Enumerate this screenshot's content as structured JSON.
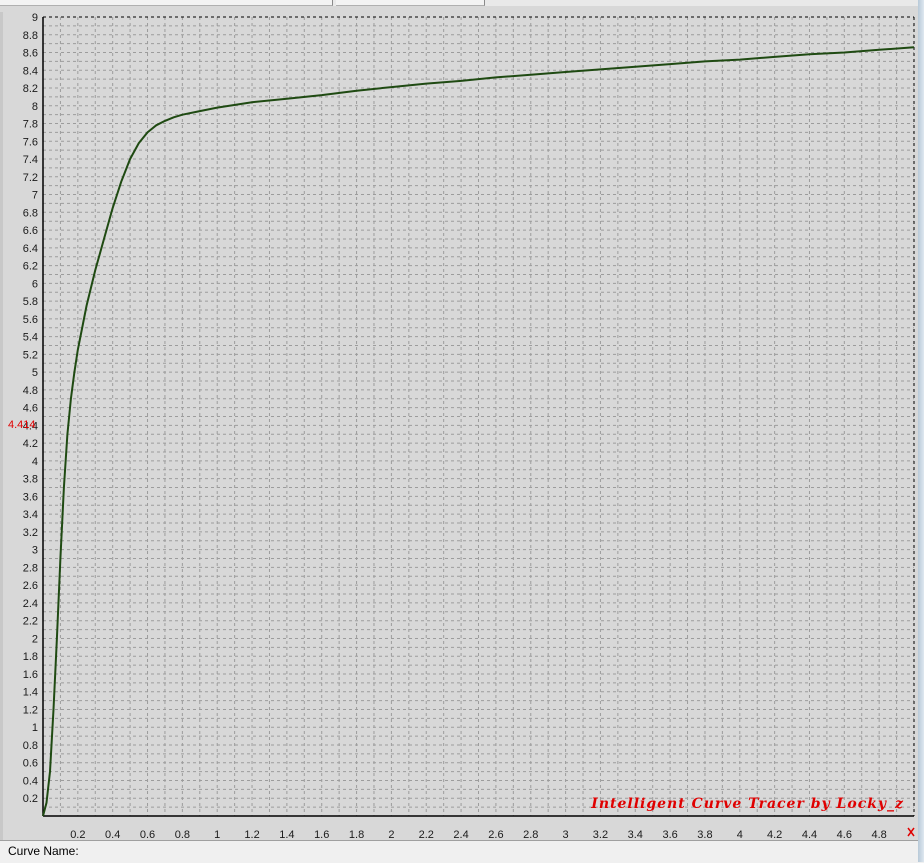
{
  "status_bar": {
    "curve_name_label": "Curve Name:"
  },
  "watermark": "Intelligent Curve Tracer by Locky_z",
  "cursor": {
    "y_value_label": "4.414"
  },
  "colors": {
    "curve": "#1f4a12",
    "grid": "#9c9c9c",
    "background": "#d8d8d8",
    "accent_red": "#e00000"
  },
  "chart_data": {
    "type": "line",
    "xlim": [
      0,
      5
    ],
    "ylim": [
      0,
      9
    ],
    "grid": true,
    "x_ticks": [
      0.2,
      0.4,
      0.6,
      0.8,
      1,
      1.2,
      1.4,
      1.6,
      1.8,
      2,
      2.2,
      2.4,
      2.6,
      2.8,
      3,
      3.2,
      3.4,
      3.6,
      3.8,
      4,
      4.2,
      4.4,
      4.6,
      4.8
    ],
    "x_tick_labels": [
      "0.2",
      "0.4",
      "0.6",
      "0.8",
      "1",
      "1.2",
      "1.4",
      "1.6",
      "1.8",
      "2",
      "2.2",
      "2.4",
      "2.6",
      "2.8",
      "3",
      "3.2",
      "3.4",
      "3.6",
      "3.8",
      "4",
      "4.2",
      "4.4",
      "4.6",
      "4.8"
    ],
    "y_ticks": [
      0.2,
      0.4,
      0.6,
      0.8,
      1,
      1.2,
      1.4,
      1.6,
      1.8,
      2,
      2.2,
      2.4,
      2.6,
      2.8,
      3,
      3.2,
      3.4,
      3.6,
      3.8,
      4,
      4.2,
      4.4,
      4.6,
      4.8,
      5,
      5.2,
      5.4,
      5.6,
      5.8,
      6,
      6.2,
      6.4,
      6.6,
      6.8,
      7,
      7.2,
      7.4,
      7.6,
      7.8,
      8,
      8.2,
      8.4,
      8.6,
      8.8,
      9
    ],
    "y_tick_labels": [
      "0.2",
      "0.4",
      "0.6",
      "0.8",
      "1",
      "1.2",
      "1.4",
      "1.6",
      "1.8",
      "2",
      "2.2",
      "2.4",
      "2.6",
      "2.8",
      "3",
      "3.2",
      "3.4",
      "3.6",
      "3.8",
      "4",
      "4.2",
      "4.4",
      "4.6",
      "4.8",
      "5",
      "5.2",
      "5.4",
      "5.6",
      "5.8",
      "6",
      "6.2",
      "6.4",
      "6.6",
      "6.8",
      "7",
      "7.2",
      "7.4",
      "7.6",
      "7.8",
      "8",
      "8.2",
      "8.4",
      "8.6",
      "8.8",
      "9"
    ],
    "series": [
      {
        "x": [
          0,
          0.02,
          0.04,
          0.06,
          0.08,
          0.1,
          0.12,
          0.14,
          0.16,
          0.18,
          0.2,
          0.25,
          0.3,
          0.35,
          0.4,
          0.45,
          0.5,
          0.55,
          0.6,
          0.65,
          0.7,
          0.75,
          0.8,
          0.9,
          1.0,
          1.2,
          1.4,
          1.6,
          1.8,
          2.0,
          2.2,
          2.4,
          2.6,
          2.8,
          3.0,
          3.2,
          3.4,
          3.6,
          3.8,
          4.0,
          4.2,
          4.4,
          4.6,
          4.8,
          5.0
        ],
        "y": [
          0,
          0.15,
          0.5,
          1.2,
          2.0,
          2.9,
          3.7,
          4.3,
          4.7,
          5.0,
          5.25,
          5.75,
          6.15,
          6.5,
          6.85,
          7.15,
          7.4,
          7.58,
          7.7,
          7.78,
          7.83,
          7.87,
          7.9,
          7.94,
          7.98,
          8.04,
          8.08,
          8.12,
          8.17,
          8.21,
          8.25,
          8.28,
          8.32,
          8.35,
          8.38,
          8.41,
          8.44,
          8.47,
          8.5,
          8.52,
          8.55,
          8.58,
          8.6,
          8.63,
          8.66
        ]
      }
    ]
  }
}
